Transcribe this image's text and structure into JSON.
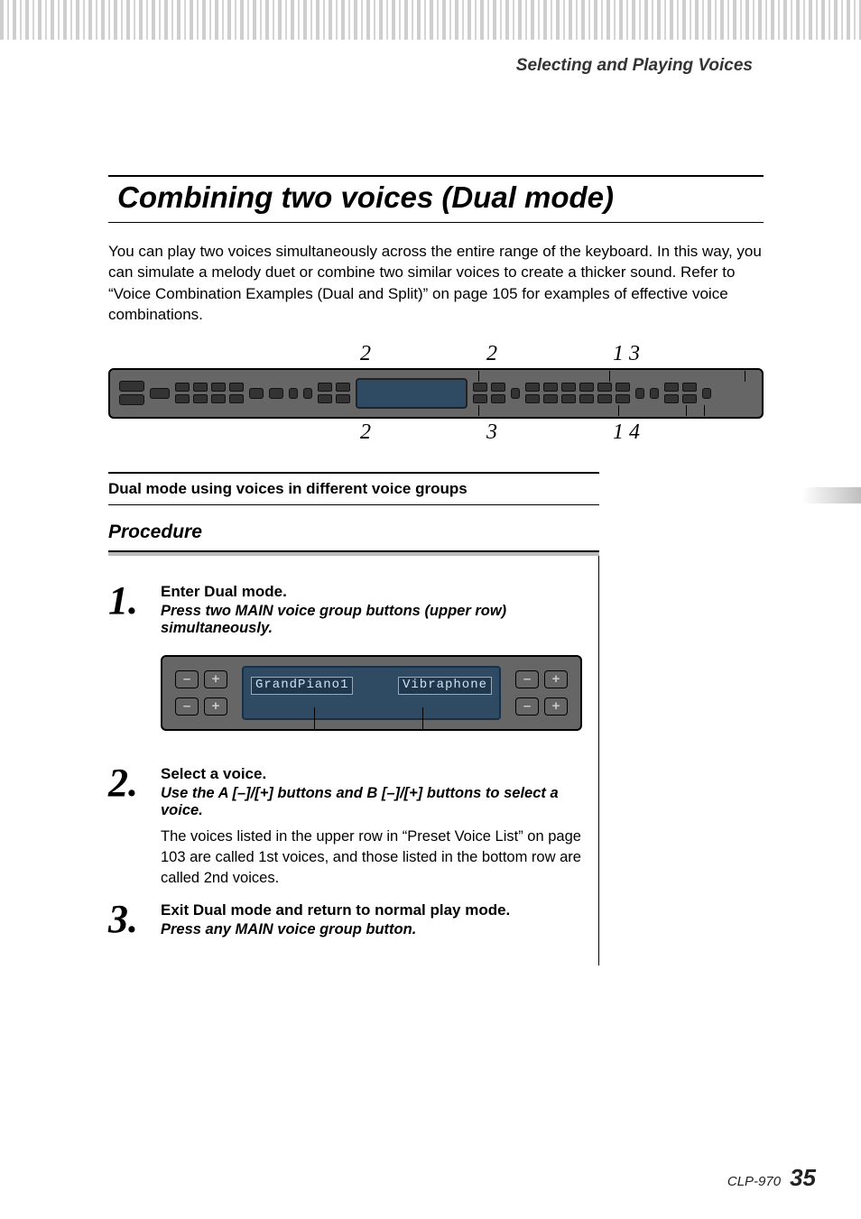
{
  "section_name": "Selecting and Playing Voices",
  "title": "Combining two voices (Dual mode)",
  "intro": "You can play two voices simultaneously across the entire range of the keyboard. In this way, you can simulate a melody duet or combine two similar voices to create a thicker sound. Refer to “Voice Combination Examples (Dual and Split)” on page 105 for examples of effective voice combinations.",
  "panel_refs": {
    "top": [
      "2",
      "2",
      "1 3"
    ],
    "bottom": [
      "2",
      "3",
      "1 4"
    ]
  },
  "subhead": "Dual mode using voices in different voice groups",
  "procedure_label": "Procedure",
  "steps": [
    {
      "num": "1.",
      "title": "Enter Dual mode.",
      "instr": "Press two MAIN voice group buttons (upper row) simultaneously.",
      "lcd": {
        "voice1": "GrandPiano1",
        "voice2": "Vibraphone"
      }
    },
    {
      "num": "2.",
      "title": "Select a voice.",
      "instr": "Use the A [–]/[+] buttons and B [–]/[+] buttons to select a voice.",
      "note": "The voices listed in the upper row in “Preset Voice List” on page 103 are called 1st voices, and those listed in the bottom row are called 2nd voices."
    },
    {
      "num": "3.",
      "title": "Exit Dual mode and return to normal play mode.",
      "instr": "Press any MAIN voice group button."
    }
  ],
  "buttons": {
    "minus": "–",
    "plus": "+"
  },
  "footer": {
    "model": "CLP-970",
    "page": "35"
  }
}
